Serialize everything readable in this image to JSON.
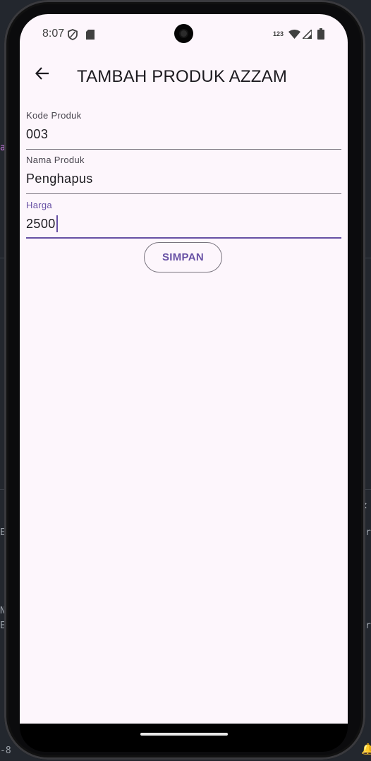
{
  "status_bar": {
    "time": "8:07",
    "network_label": "123",
    "icons": [
      "shield-icon",
      "sd-card-icon",
      "wifi-icon",
      "signal-icon",
      "battery-icon"
    ]
  },
  "app_bar": {
    "title": "TAMBAH PRODUK AZZAM",
    "back_icon": "arrow-back-icon"
  },
  "form": {
    "fields": [
      {
        "label": "Kode Produk",
        "value": "003"
      },
      {
        "label": "Nama Produk",
        "value": "Penghapus"
      },
      {
        "label": "Harga",
        "value": "2500"
      }
    ],
    "save_label": "SIMPAN"
  },
  "background_ide": {
    "fragments": [
      "a",
      "E",
      "N",
      "E",
      "-8",
      "r",
      "r"
    ]
  },
  "colors": {
    "accent": "#6750a4",
    "screen_bg": "#fdf6fc",
    "text": "#1d1b20",
    "underline": "#79747e"
  }
}
